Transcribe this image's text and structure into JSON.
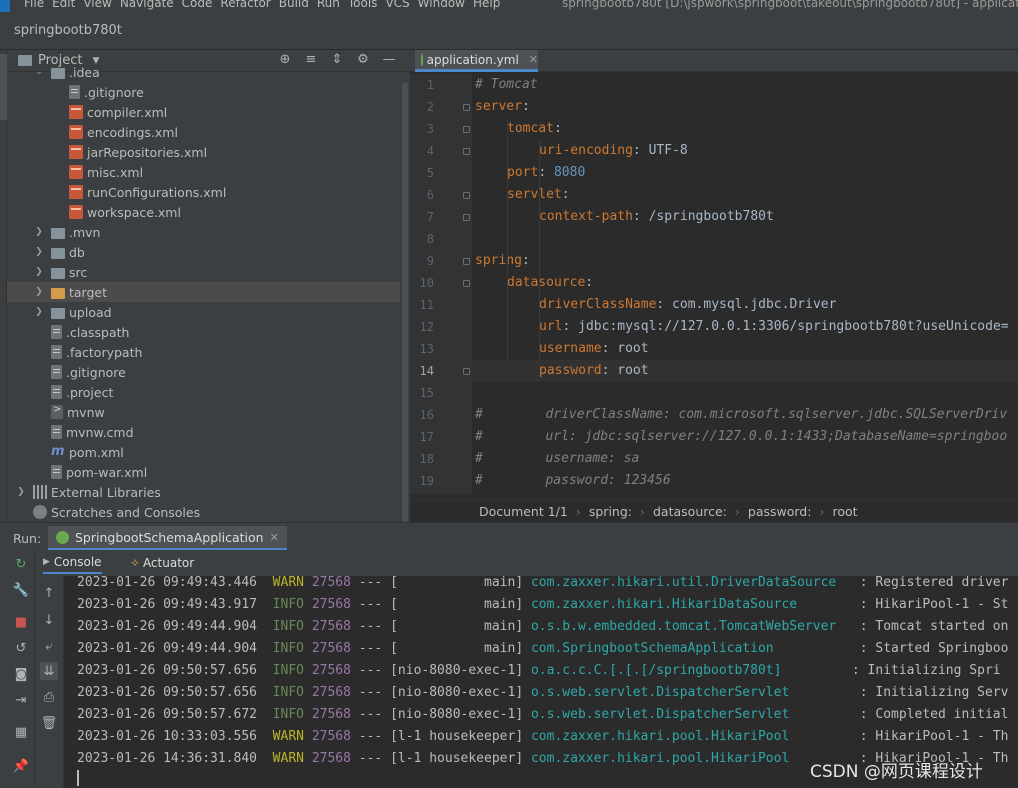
{
  "menubar": {
    "items": [
      "File",
      "Edit",
      "View",
      "Navigate",
      "Code",
      "Refactor",
      "Build",
      "Run",
      "Tools",
      "VCS",
      "Window",
      "Help"
    ],
    "window_title": "springbootb780t [D:\\jspwork\\springboot\\takeout\\springbootb780t] - applicati"
  },
  "project_bar": {
    "title": "springbootb780t"
  },
  "project_panel": {
    "title": "Project",
    "tools": [
      "locate-icon",
      "expand-all-icon",
      "collapse-all-icon",
      "gear-icon",
      "hide-icon"
    ],
    "tree": [
      {
        "label": ".idea",
        "icon": "folder",
        "indent": 1,
        "arrow": "down"
      },
      {
        "label": ".gitignore",
        "icon": "file",
        "indent": 2
      },
      {
        "label": "compiler.xml",
        "icon": "xml",
        "indent": 2
      },
      {
        "label": "encodings.xml",
        "icon": "xml",
        "indent": 2
      },
      {
        "label": "jarRepositories.xml",
        "icon": "xml",
        "indent": 2
      },
      {
        "label": "misc.xml",
        "icon": "xml",
        "indent": 2
      },
      {
        "label": "runConfigurations.xml",
        "icon": "xml",
        "indent": 2
      },
      {
        "label": "workspace.xml",
        "icon": "xml",
        "indent": 2
      },
      {
        "label": ".mvn",
        "icon": "folder",
        "indent": 1,
        "arrow": "right"
      },
      {
        "label": "db",
        "icon": "folder",
        "indent": 1,
        "arrow": "right"
      },
      {
        "label": "src",
        "icon": "folder",
        "indent": 1,
        "arrow": "right"
      },
      {
        "label": "target",
        "icon": "folder-orange",
        "indent": 1,
        "arrow": "right",
        "selected": true
      },
      {
        "label": "upload",
        "icon": "folder",
        "indent": 1,
        "arrow": "right"
      },
      {
        "label": ".classpath",
        "icon": "file",
        "indent": 1
      },
      {
        "label": ".factorypath",
        "icon": "file",
        "indent": 1
      },
      {
        "label": ".gitignore",
        "icon": "file",
        "indent": 1
      },
      {
        "label": ".project",
        "icon": "file",
        "indent": 1
      },
      {
        "label": "mvnw",
        "icon": "term",
        "indent": 1
      },
      {
        "label": "mvnw.cmd",
        "icon": "file",
        "indent": 1
      },
      {
        "label": "pom.xml",
        "icon": "maven",
        "indent": 1
      },
      {
        "label": "pom-war.xml",
        "icon": "file",
        "indent": 1
      },
      {
        "label": "External Libraries",
        "icon": "lib",
        "indent": 0,
        "arrow": "right"
      },
      {
        "label": "Scratches and Consoles",
        "icon": "scratch",
        "indent": 0
      }
    ]
  },
  "editor": {
    "tab_label": "application.yml",
    "current_line": 14,
    "lines": [
      {
        "n": 1,
        "indent": 0,
        "parts": [
          {
            "t": "# Tomcat",
            "c": "cm"
          }
        ]
      },
      {
        "n": 2,
        "indent": 0,
        "fold": true,
        "parts": [
          {
            "t": "server",
            "c": "ky"
          },
          {
            "t": ":",
            "c": "vl"
          }
        ]
      },
      {
        "n": 3,
        "indent": 1,
        "fold": true,
        "parts": [
          {
            "t": "tomcat",
            "c": "ky"
          },
          {
            "t": ":",
            "c": "vl"
          }
        ]
      },
      {
        "n": 4,
        "indent": 2,
        "fold": true,
        "parts": [
          {
            "t": "uri-encoding",
            "c": "ky"
          },
          {
            "t": ": UTF-8",
            "c": "vl"
          }
        ]
      },
      {
        "n": 5,
        "indent": 1,
        "parts": [
          {
            "t": "port",
            "c": "ky"
          },
          {
            "t": ": ",
            "c": "vl"
          },
          {
            "t": "8080",
            "c": "nm"
          }
        ]
      },
      {
        "n": 6,
        "indent": 1,
        "fold": true,
        "parts": [
          {
            "t": "servlet",
            "c": "ky"
          },
          {
            "t": ":",
            "c": "vl"
          }
        ]
      },
      {
        "n": 7,
        "indent": 2,
        "fold": true,
        "parts": [
          {
            "t": "context-path",
            "c": "ky"
          },
          {
            "t": ": /springbootb780t",
            "c": "vl"
          }
        ]
      },
      {
        "n": 8,
        "indent": 0,
        "parts": []
      },
      {
        "n": 9,
        "indent": 0,
        "fold": true,
        "parts": [
          {
            "t": "spring",
            "c": "ky"
          },
          {
            "t": ":",
            "c": "vl"
          }
        ]
      },
      {
        "n": 10,
        "indent": 1,
        "fold": true,
        "parts": [
          {
            "t": "datasource",
            "c": "ky"
          },
          {
            "t": ":",
            "c": "vl"
          }
        ]
      },
      {
        "n": 11,
        "indent": 2,
        "parts": [
          {
            "t": "driverClassName",
            "c": "ky"
          },
          {
            "t": ": com.mysql.jdbc.Driver",
            "c": "vl"
          }
        ]
      },
      {
        "n": 12,
        "indent": 2,
        "parts": [
          {
            "t": "url",
            "c": "ky"
          },
          {
            "t": ": jdbc:mysql://127.0.0.1:3306/springbootb780t?useUnicode=",
            "c": "vl"
          }
        ]
      },
      {
        "n": 13,
        "indent": 2,
        "parts": [
          {
            "t": "username",
            "c": "ky"
          },
          {
            "t": ": root",
            "c": "vl"
          }
        ]
      },
      {
        "n": 14,
        "indent": 2,
        "fold": true,
        "parts": [
          {
            "t": "password",
            "c": "ky"
          },
          {
            "t": ": root",
            "c": "vl"
          }
        ]
      },
      {
        "n": 15,
        "indent": 0,
        "parts": []
      },
      {
        "n": 16,
        "indent": 0,
        "parts": [
          {
            "t": "#        driverClassName: com.microsoft.sqlserver.jdbc.SQLServerDriv",
            "c": "cm"
          }
        ]
      },
      {
        "n": 17,
        "indent": 0,
        "parts": [
          {
            "t": "#        url: jdbc:sqlserver://127.0.0.1:1433;DatabaseName=springboo",
            "c": "cm"
          }
        ]
      },
      {
        "n": 18,
        "indent": 0,
        "parts": [
          {
            "t": "#        username: sa",
            "c": "cm"
          }
        ]
      },
      {
        "n": 19,
        "indent": 0,
        "parts": [
          {
            "t": "#        password: 123456",
            "c": "cm"
          }
        ]
      }
    ],
    "breadcrumb": [
      "Document 1/1",
      "spring:",
      "datasource:",
      "password:",
      "root"
    ]
  },
  "run": {
    "label": "Run:",
    "tab_label": "SpringbootSchemaApplication",
    "subtabs": {
      "console": "Console",
      "actuator": "Actuator"
    },
    "log": [
      {
        "ts": "2023-01-26 09:49:43.446",
        "level": "WARN",
        "pid": "27568",
        "sep": "---",
        "thread": "[           main]",
        "logger": "com.zaxxer.hikari.util.DriverDataSource  ",
        "msg": " : Registered driver"
      },
      {
        "ts": "2023-01-26 09:49:43.917",
        "level": "INFO",
        "pid": "27568",
        "sep": "---",
        "thread": "[           main]",
        "logger": "com.zaxxer.hikari.HikariDataSource       ",
        "msg": " : HikariPool-1 - St"
      },
      {
        "ts": "2023-01-26 09:49:44.904",
        "level": "INFO",
        "pid": "27568",
        "sep": "---",
        "thread": "[           main]",
        "logger": "o.s.b.w.embedded.tomcat.TomcatWebServer  ",
        "msg": " : Tomcat started on"
      },
      {
        "ts": "2023-01-26 09:49:44.904",
        "level": "INFO",
        "pid": "27568",
        "sep": "---",
        "thread": "[           main]",
        "logger": "com.SpringbootSchemaApplication          ",
        "msg": " : Started Springboo"
      },
      {
        "ts": "2023-01-26 09:50:57.656",
        "level": "INFO",
        "pid": "27568",
        "sep": "---",
        "thread": "[nio-8080-exec-1]",
        "logger": "o.a.c.c.C.[.[.[/springbootb780t]        ",
        "msg": " : Initializing Spri"
      },
      {
        "ts": "2023-01-26 09:50:57.656",
        "level": "INFO",
        "pid": "27568",
        "sep": "---",
        "thread": "[nio-8080-exec-1]",
        "logger": "o.s.web.servlet.DispatcherServlet        ",
        "msg": " : Initializing Serv"
      },
      {
        "ts": "2023-01-26 09:50:57.672",
        "level": "INFO",
        "pid": "27568",
        "sep": "---",
        "thread": "[nio-8080-exec-1]",
        "logger": "o.s.web.servlet.DispatcherServlet        ",
        "msg": " : Completed initial"
      },
      {
        "ts": "2023-01-26 10:33:03.556",
        "level": "WARN",
        "pid": "27568",
        "sep": "---",
        "thread": "[l-1 housekeeper]",
        "logger": "com.zaxxer.hikari.pool.HikariPool        ",
        "msg": " : HikariPool-1 - Th"
      },
      {
        "ts": "2023-01-26 14:36:31.840",
        "level": "WARN",
        "pid": "27568",
        "sep": "---",
        "thread": "[l-1 housekeeper]",
        "logger": "com.zaxxer.hikari.pool.HikariPool        ",
        "msg": " : HikariPool-1 - Th"
      }
    ]
  },
  "watermark": "CSDN @网页课程设计",
  "colors": {
    "background": "#2b2b2b",
    "panel": "#3c3f41",
    "accent": "#4a88c7",
    "yaml_key": "#cc7832",
    "number": "#6897bb",
    "comment": "#808080",
    "log_info": "#6a8759",
    "log_warn": "#bbb529",
    "log_pid": "#9876aa",
    "log_logger": "#2fa7a7"
  }
}
